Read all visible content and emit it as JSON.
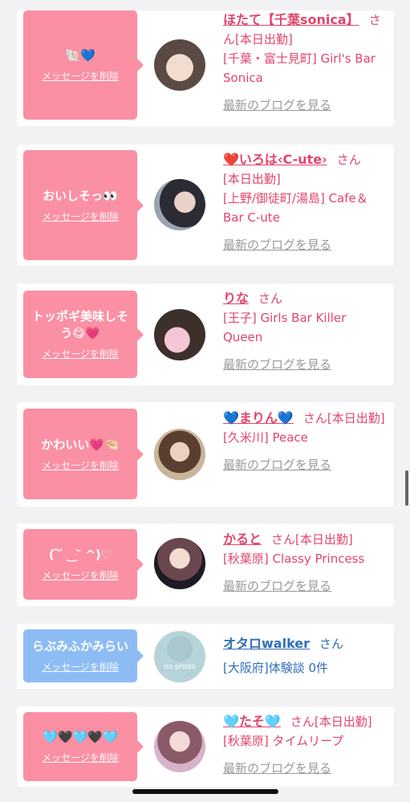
{
  "delete_label": "メッセージを削除",
  "blog_label": "最新のブログを見る",
  "san": "さん",
  "cards": [
    {
      "message": "🐚💙",
      "name": "ほたて【千葉sonica】",
      "status": "[本日出勤]",
      "area": "[千葉・富士見町] Girl's Bar Sonica"
    },
    {
      "message": "おいしそっ👀",
      "name": "❤️いろは‹C-ute›",
      "status": "[本日出勤]",
      "area": "[上野/御徒町/湯島] Cafe＆Bar C-ute"
    },
    {
      "message": "トッポギ美味しそう😋💗",
      "name": "りな",
      "area": "[王子] Girls Bar Killer Queen"
    },
    {
      "message": "かわいい💗🤏🏻",
      "name": "💙まりん💙",
      "status": "[本日出勤]",
      "area": "[久米川] Peace"
    },
    {
      "message": "( ᷇ ᷄ ‿ ᷅ ^)♡",
      "name": "かると",
      "status": "[本日出勤]",
      "area": "[秋葉原] Classy Princess"
    },
    {
      "message": "らぶみふかみらい",
      "name": "オタロwalker",
      "area": "[大阪府]体験談 0件",
      "avatar_text": "no photo"
    },
    {
      "message": "🩵🖤🩵🖤🩵",
      "name": "🩵たそ🩵",
      "status": "[本日出勤]",
      "area": "[秋葉原] タイムリープ"
    }
  ]
}
